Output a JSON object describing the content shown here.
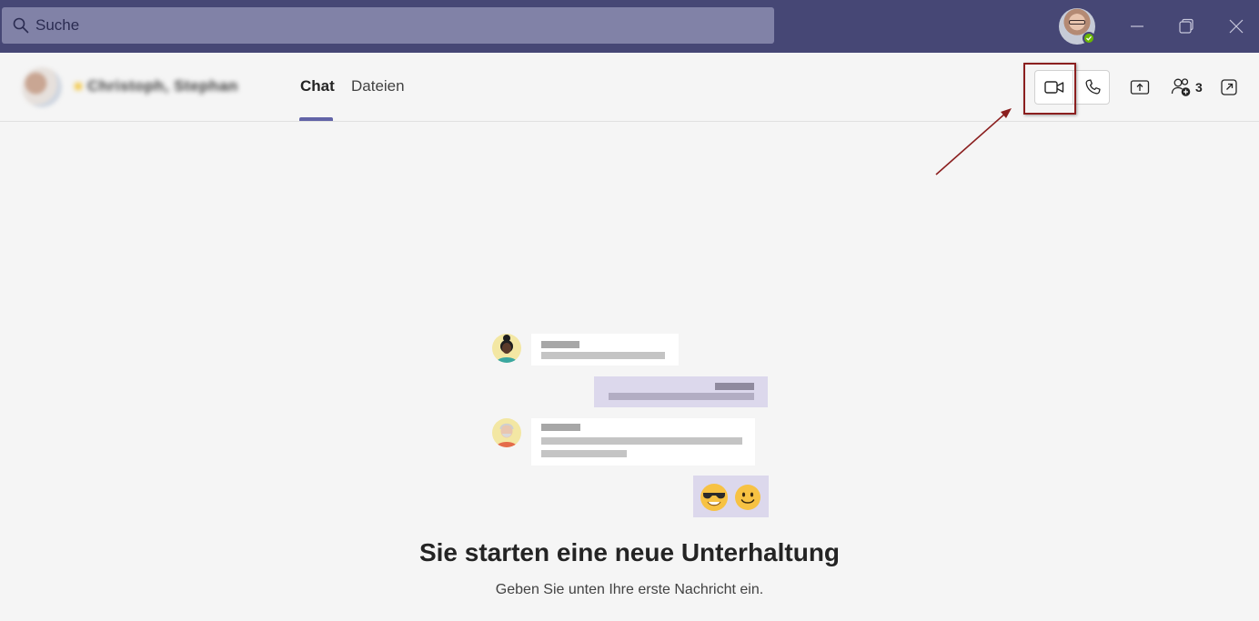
{
  "search": {
    "placeholder": "Suche"
  },
  "chat_header": {
    "participants_text": "Christoph, Stephan",
    "tabs": [
      {
        "label": "Chat",
        "active": true
      },
      {
        "label": "Dateien",
        "active": false
      }
    ],
    "participant_count": "3"
  },
  "empty_state": {
    "title": "Sie starten eine neue Unterhaltung",
    "subtitle": "Geben Sie unten Ihre erste Nachricht ein."
  },
  "colors": {
    "titlebar": "#464775",
    "accent": "#6264a7",
    "annotation": "#8b1f1f"
  }
}
